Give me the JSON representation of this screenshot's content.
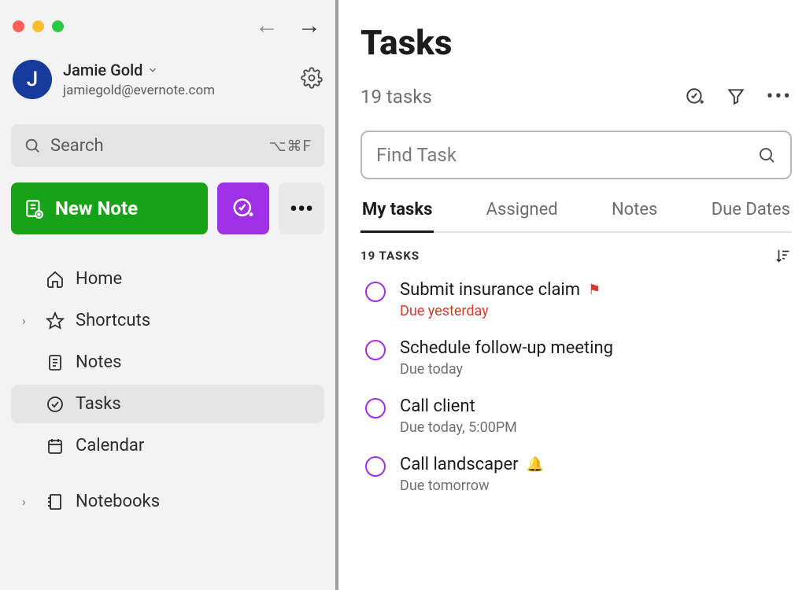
{
  "account": {
    "initial": "J",
    "name": "Jamie Gold",
    "email": "jamiegold@evernote.com"
  },
  "search": {
    "placeholder": "Search",
    "shortcut": "⌥⌘F"
  },
  "actions": {
    "new_note": "New Note"
  },
  "nav": {
    "home": "Home",
    "shortcuts": "Shortcuts",
    "notes": "Notes",
    "tasks": "Tasks",
    "calendar": "Calendar",
    "notebooks": "Notebooks"
  },
  "main": {
    "title": "Tasks",
    "count_text": "19 tasks",
    "find_placeholder": "Find Task",
    "tabs": {
      "my_tasks": "My tasks",
      "assigned": "Assigned",
      "notes": "Notes",
      "due_dates": "Due Dates"
    },
    "list_header": "19 TASKS",
    "tasks": [
      {
        "title": "Submit insurance claim",
        "due": "Due yesterday",
        "overdue": true,
        "flag": true,
        "bell": false
      },
      {
        "title": "Schedule follow-up meeting",
        "due": "Due today",
        "overdue": false,
        "flag": false,
        "bell": false
      },
      {
        "title": "Call client",
        "due": "Due today, 5:00PM",
        "overdue": false,
        "flag": false,
        "bell": false
      },
      {
        "title": "Call landscaper",
        "due": "Due tomorrow",
        "overdue": false,
        "flag": false,
        "bell": true
      }
    ]
  }
}
